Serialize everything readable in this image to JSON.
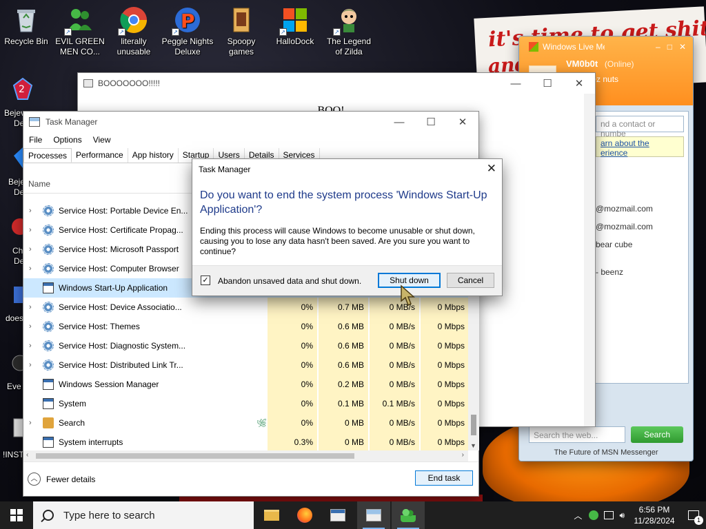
{
  "desktop": {
    "icons": [
      {
        "label": "Recycle Bin",
        "icon": "recycle-bin-icon"
      },
      {
        "label": "EVIL GREEN MEN CO...",
        "icon": "msn-people-icon"
      },
      {
        "label": "literally unusable",
        "icon": "chrome-icon"
      },
      {
        "label": "Peggle Nights Deluxe",
        "icon": "peggle-icon"
      },
      {
        "label": "Spoopy games",
        "icon": "folder-icon"
      },
      {
        "label": "HalloDock",
        "icon": "windows-flag-icon"
      },
      {
        "label": "The Legend of Zilda",
        "icon": "zilda-icon"
      }
    ],
    "side_labels": [
      "Bejev",
      "De",
      "Beje",
      "De",
      "Ch",
      "De",
      "does",
      "Eve",
      "!INST"
    ],
    "wallpaper_text_1": "it's time to get shit",
    "wallpaper_text_2": "and"
  },
  "boo_window": {
    "title": "BOOOOOOO!!!!!",
    "body": "BOO!"
  },
  "msn": {
    "title": "Windows Live Messenger",
    "username": "VM0b0t",
    "status": "(Online)",
    "personal_message": "rate deez nuts",
    "search_contacts_placeholder": "nd a contact or numbe",
    "banner_line1": "arn about the",
    "banner_line2": "erience",
    "contacts": [
      "@mozmail.com",
      "@mozmail.com",
      "bear cube",
      "- beenz"
    ],
    "search_web_placeholder": "Search the web...",
    "search_button": "Search",
    "footer": "The Future of MSN Messenger"
  },
  "task_manager": {
    "title": "Task Manager",
    "menu": [
      "File",
      "Options",
      "View"
    ],
    "tabs": [
      "Processes",
      "Performance",
      "App history",
      "Startup",
      "Users",
      "Details",
      "Services"
    ],
    "active_tab": "Processes",
    "name_column": "Name",
    "processes": [
      {
        "name": "Service Host: Portable Device En...",
        "icon": "gear",
        "expand": true,
        "cpu": "",
        "mem": "",
        "disk": "",
        "net": ""
      },
      {
        "name": "Service Host: Certificate Propag...",
        "icon": "gear",
        "expand": true,
        "cpu": "",
        "mem": "",
        "disk": "",
        "net": ""
      },
      {
        "name": "Service Host: Microsoft Passport",
        "icon": "gear",
        "expand": true,
        "cpu": "",
        "mem": "",
        "disk": "",
        "net": ""
      },
      {
        "name": "Service Host: Computer Browser",
        "icon": "gear",
        "expand": true,
        "cpu": "",
        "mem": "",
        "disk": "",
        "net": ""
      },
      {
        "name": "Windows Start-Up Application",
        "icon": "app",
        "expand": false,
        "selected": true,
        "cpu": "",
        "mem": "",
        "disk": "",
        "net": ""
      },
      {
        "name": "Service Host: Device Associatio...",
        "icon": "gear",
        "expand": true,
        "cpu": "0%",
        "mem": "0.7 MB",
        "disk": "0 MB/s",
        "net": "0 Mbps"
      },
      {
        "name": "Service Host: Themes",
        "icon": "gear",
        "expand": true,
        "cpu": "0%",
        "mem": "0.6 MB",
        "disk": "0 MB/s",
        "net": "0 Mbps"
      },
      {
        "name": "Service Host: Diagnostic System...",
        "icon": "gear",
        "expand": true,
        "cpu": "0%",
        "mem": "0.6 MB",
        "disk": "0 MB/s",
        "net": "0 Mbps"
      },
      {
        "name": "Service Host: Distributed Link Tr...",
        "icon": "gear",
        "expand": true,
        "cpu": "0%",
        "mem": "0.6 MB",
        "disk": "0 MB/s",
        "net": "0 Mbps"
      },
      {
        "name": "Windows Session Manager",
        "icon": "app",
        "expand": false,
        "cpu": "0%",
        "mem": "0.2 MB",
        "disk": "0 MB/s",
        "net": "0 Mbps"
      },
      {
        "name": "System",
        "icon": "app",
        "expand": false,
        "cpu": "0%",
        "mem": "0.1 MB",
        "disk": "0.1 MB/s",
        "net": "0 Mbps"
      },
      {
        "name": "Search",
        "icon": "search",
        "expand": true,
        "leaf": true,
        "cpu": "0%",
        "mem": "0 MB",
        "disk": "0 MB/s",
        "net": "0 Mbps"
      },
      {
        "name": "System interrupts",
        "icon": "app",
        "expand": false,
        "cpu": "0.3%",
        "mem": "0 MB",
        "disk": "0 MB/s",
        "net": "0 Mbps"
      }
    ],
    "fewer_details": "Fewer details",
    "end_task": "End task"
  },
  "dialog": {
    "title": "Task Manager",
    "heading": "Do you want to end the system process 'Windows Start-Up Application'?",
    "body": "Ending this process will cause Windows to become unusable or shut down, causing you to lose any data hasn't been saved. Are you sure you want to continue?",
    "checkbox_label": "Abandon unsaved data and shut down.",
    "checkbox_checked": true,
    "primary_button": "Shut down",
    "cancel_button": "Cancel"
  },
  "taskbar": {
    "search_placeholder": "Type here to search",
    "time": "6:56 PM",
    "date": "11/28/2024",
    "notification_count": "1"
  }
}
